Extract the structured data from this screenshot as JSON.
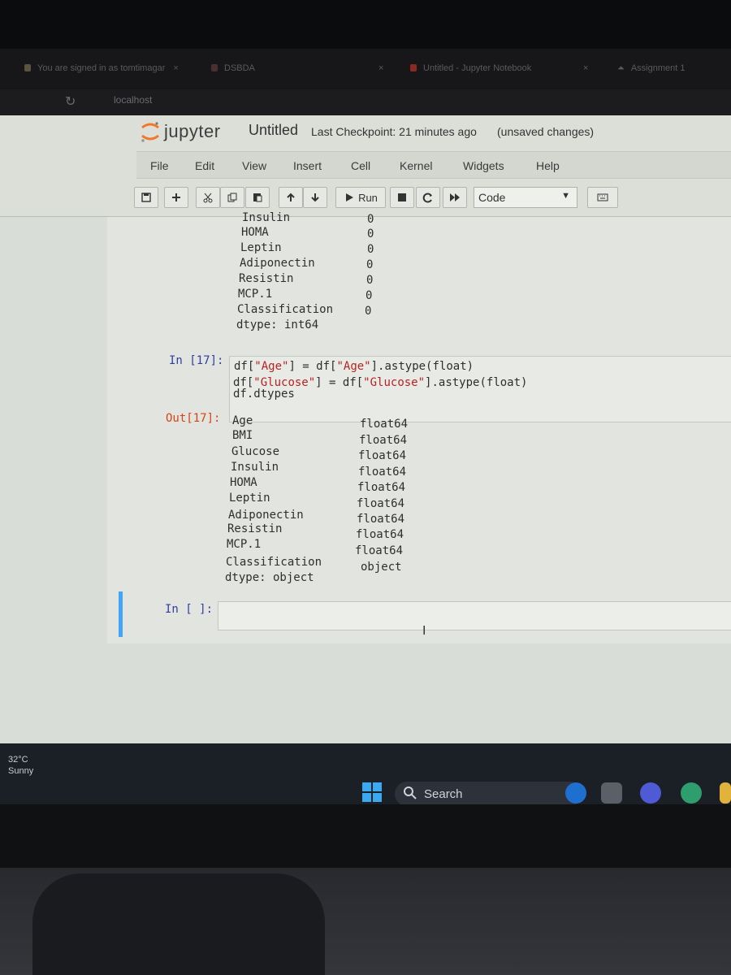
{
  "browser": {
    "tabs": [
      {
        "label": "You are signed in as tomtimagar",
        "close": "×"
      },
      {
        "label": "DSBDA",
        "close": "×"
      },
      {
        "label": "Untitled - Jupyter Notebook",
        "close": "×"
      },
      {
        "label": "Assignment 1",
        "close": ""
      }
    ],
    "reload_icon": "reload-icon",
    "url": "localhost"
  },
  "notebook": {
    "logo_text": "jupyter",
    "title": "Untitled",
    "checkpoint": "Last Checkpoint: 21 minutes ago",
    "status": "(unsaved changes)",
    "menu": [
      "File",
      "Edit",
      "View",
      "Insert",
      "Cell",
      "Kernel",
      "Widgets",
      "Help"
    ],
    "toolbar": {
      "run_label": "Run",
      "cell_type": "Code",
      "icons": [
        "save-icon",
        "add-icon",
        "cut-icon",
        "copy-icon",
        "paste-icon",
        "move-up-icon",
        "move-down-icon",
        "run-icon",
        "stop-icon",
        "restart-icon",
        "fast-forward-icon",
        "keyboard-icon"
      ]
    },
    "prev_output": [
      {
        "name": "Insulin",
        "value": "0"
      },
      {
        "name": "HOMA",
        "value": "0"
      },
      {
        "name": "Leptin",
        "value": "0"
      },
      {
        "name": "Adiponectin",
        "value": "0"
      },
      {
        "name": "Resistin",
        "value": "0"
      },
      {
        "name": "MCP.1",
        "value": "0"
      },
      {
        "name": "Classification",
        "value": "0"
      }
    ],
    "prev_dtype": "dtype: int64",
    "cell17": {
      "in_prompt": "In [17]:",
      "out_prompt": "Out[17]:",
      "code": [
        {
          "a": "df[",
          "s1": "\"Age\"",
          "b": "] =  df[",
          "s2": "\"Age\"",
          "c": "].astype(float)"
        },
        {
          "a": "df[",
          "s1": "\"Glucose\"",
          "b": "] =  df[",
          "s2": "\"Glucose\"",
          "c": "].astype(float)"
        },
        {
          "a": "df.dtypes",
          "s1": "",
          "b": "",
          "s2": "",
          "c": ""
        }
      ],
      "output": [
        {
          "name": "Age",
          "value": "float64"
        },
        {
          "name": "BMI",
          "value": "float64"
        },
        {
          "name": "Glucose",
          "value": "float64"
        },
        {
          "name": "Insulin",
          "value": "float64"
        },
        {
          "name": "HOMA",
          "value": "float64"
        },
        {
          "name": "Leptin",
          "value": "float64"
        },
        {
          "name": "Adiponectin",
          "value": "float64"
        },
        {
          "name": "Resistin",
          "value": "float64"
        },
        {
          "name": "MCP.1",
          "value": "float64"
        },
        {
          "name": "Classification",
          "value": "object"
        }
      ],
      "dtype": "dtype: object"
    },
    "empty_cell_prompt": "In [ ]:",
    "text_cursor": "I"
  },
  "taskbar": {
    "temperature": "32°C",
    "weather": "Sunny",
    "search_label": "Search",
    "colors": {
      "accent": "#42a5f5",
      "prompt_in": "#303f9f",
      "prompt_out": "#d84315",
      "string": "#ba2121"
    }
  }
}
